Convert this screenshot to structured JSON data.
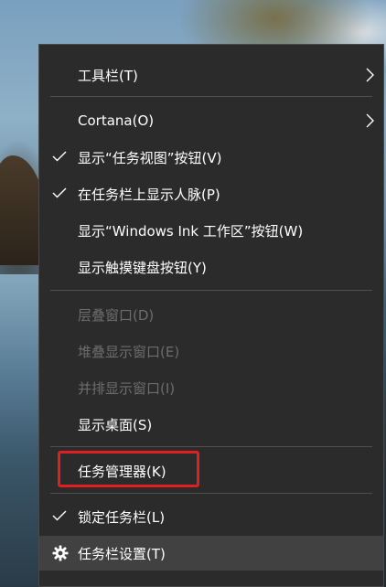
{
  "menu": {
    "items": [
      {
        "label": "工具栏(T)",
        "checked": false,
        "disabled": false,
        "submenu": true
      },
      {
        "label": "Cortana(O)",
        "checked": false,
        "disabled": false,
        "submenu": true
      },
      {
        "label": "显示“任务视图”按钮(V)",
        "checked": true,
        "disabled": false,
        "submenu": false
      },
      {
        "label": "在任务栏上显示人脉(P)",
        "checked": true,
        "disabled": false,
        "submenu": false
      },
      {
        "label": "显示“Windows Ink 工作区”按钮(W)",
        "checked": false,
        "disabled": false,
        "submenu": false
      },
      {
        "label": "显示触摸键盘按钮(Y)",
        "checked": false,
        "disabled": false,
        "submenu": false
      },
      {
        "label": "层叠窗口(D)",
        "checked": false,
        "disabled": true,
        "submenu": false
      },
      {
        "label": "堆叠显示窗口(E)",
        "checked": false,
        "disabled": true,
        "submenu": false
      },
      {
        "label": "并排显示窗口(I)",
        "checked": false,
        "disabled": true,
        "submenu": false
      },
      {
        "label": "显示桌面(S)",
        "checked": false,
        "disabled": false,
        "submenu": false
      },
      {
        "label": "任务管理器(K)",
        "checked": false,
        "disabled": false,
        "submenu": false,
        "highlighted": true
      },
      {
        "label": "锁定任务栏(L)",
        "checked": true,
        "disabled": false,
        "submenu": false
      },
      {
        "label": "任务栏设置(T)",
        "checked": false,
        "disabled": false,
        "submenu": false,
        "icon": "gear-icon",
        "hovered": true
      }
    ]
  },
  "colors": {
    "menu_background": "#2b2b2b",
    "text": "#ffffff",
    "disabled_text": "#6d6d6d",
    "separator": "#505050",
    "hover": "#414141",
    "highlight_box": "#e02020"
  }
}
